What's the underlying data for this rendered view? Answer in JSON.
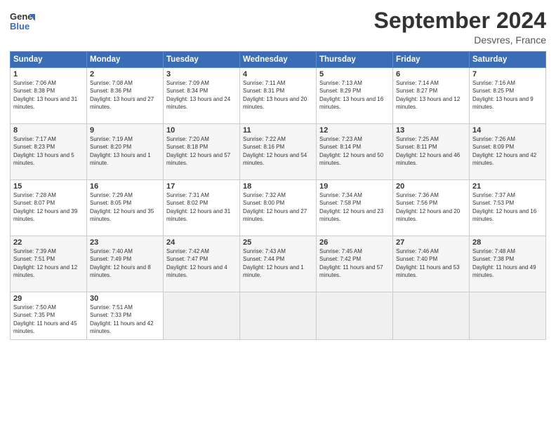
{
  "header": {
    "month_title": "September 2024",
    "location": "Desvres, France",
    "logo_line1": "General",
    "logo_line2": "Blue"
  },
  "days_of_week": [
    "Sunday",
    "Monday",
    "Tuesday",
    "Wednesday",
    "Thursday",
    "Friday",
    "Saturday"
  ],
  "weeks": [
    [
      {
        "day": "1",
        "sunrise": "Sunrise: 7:06 AM",
        "sunset": "Sunset: 8:38 PM",
        "daylight": "Daylight: 13 hours and 31 minutes."
      },
      {
        "day": "2",
        "sunrise": "Sunrise: 7:08 AM",
        "sunset": "Sunset: 8:36 PM",
        "daylight": "Daylight: 13 hours and 27 minutes."
      },
      {
        "day": "3",
        "sunrise": "Sunrise: 7:09 AM",
        "sunset": "Sunset: 8:34 PM",
        "daylight": "Daylight: 13 hours and 24 minutes."
      },
      {
        "day": "4",
        "sunrise": "Sunrise: 7:11 AM",
        "sunset": "Sunset: 8:31 PM",
        "daylight": "Daylight: 13 hours and 20 minutes."
      },
      {
        "day": "5",
        "sunrise": "Sunrise: 7:13 AM",
        "sunset": "Sunset: 8:29 PM",
        "daylight": "Daylight: 13 hours and 16 minutes."
      },
      {
        "day": "6",
        "sunrise": "Sunrise: 7:14 AM",
        "sunset": "Sunset: 8:27 PM",
        "daylight": "Daylight: 13 hours and 12 minutes."
      },
      {
        "day": "7",
        "sunrise": "Sunrise: 7:16 AM",
        "sunset": "Sunset: 8:25 PM",
        "daylight": "Daylight: 13 hours and 9 minutes."
      }
    ],
    [
      {
        "day": "8",
        "sunrise": "Sunrise: 7:17 AM",
        "sunset": "Sunset: 8:23 PM",
        "daylight": "Daylight: 13 hours and 5 minutes."
      },
      {
        "day": "9",
        "sunrise": "Sunrise: 7:19 AM",
        "sunset": "Sunset: 8:20 PM",
        "daylight": "Daylight: 13 hours and 1 minute."
      },
      {
        "day": "10",
        "sunrise": "Sunrise: 7:20 AM",
        "sunset": "Sunset: 8:18 PM",
        "daylight": "Daylight: 12 hours and 57 minutes."
      },
      {
        "day": "11",
        "sunrise": "Sunrise: 7:22 AM",
        "sunset": "Sunset: 8:16 PM",
        "daylight": "Daylight: 12 hours and 54 minutes."
      },
      {
        "day": "12",
        "sunrise": "Sunrise: 7:23 AM",
        "sunset": "Sunset: 8:14 PM",
        "daylight": "Daylight: 12 hours and 50 minutes."
      },
      {
        "day": "13",
        "sunrise": "Sunrise: 7:25 AM",
        "sunset": "Sunset: 8:11 PM",
        "daylight": "Daylight: 12 hours and 46 minutes."
      },
      {
        "day": "14",
        "sunrise": "Sunrise: 7:26 AM",
        "sunset": "Sunset: 8:09 PM",
        "daylight": "Daylight: 12 hours and 42 minutes."
      }
    ],
    [
      {
        "day": "15",
        "sunrise": "Sunrise: 7:28 AM",
        "sunset": "Sunset: 8:07 PM",
        "daylight": "Daylight: 12 hours and 39 minutes."
      },
      {
        "day": "16",
        "sunrise": "Sunrise: 7:29 AM",
        "sunset": "Sunset: 8:05 PM",
        "daylight": "Daylight: 12 hours and 35 minutes."
      },
      {
        "day": "17",
        "sunrise": "Sunrise: 7:31 AM",
        "sunset": "Sunset: 8:02 PM",
        "daylight": "Daylight: 12 hours and 31 minutes."
      },
      {
        "day": "18",
        "sunrise": "Sunrise: 7:32 AM",
        "sunset": "Sunset: 8:00 PM",
        "daylight": "Daylight: 12 hours and 27 minutes."
      },
      {
        "day": "19",
        "sunrise": "Sunrise: 7:34 AM",
        "sunset": "Sunset: 7:58 PM",
        "daylight": "Daylight: 12 hours and 23 minutes."
      },
      {
        "day": "20",
        "sunrise": "Sunrise: 7:36 AM",
        "sunset": "Sunset: 7:56 PM",
        "daylight": "Daylight: 12 hours and 20 minutes."
      },
      {
        "day": "21",
        "sunrise": "Sunrise: 7:37 AM",
        "sunset": "Sunset: 7:53 PM",
        "daylight": "Daylight: 12 hours and 16 minutes."
      }
    ],
    [
      {
        "day": "22",
        "sunrise": "Sunrise: 7:39 AM",
        "sunset": "Sunset: 7:51 PM",
        "daylight": "Daylight: 12 hours and 12 minutes."
      },
      {
        "day": "23",
        "sunrise": "Sunrise: 7:40 AM",
        "sunset": "Sunset: 7:49 PM",
        "daylight": "Daylight: 12 hours and 8 minutes."
      },
      {
        "day": "24",
        "sunrise": "Sunrise: 7:42 AM",
        "sunset": "Sunset: 7:47 PM",
        "daylight": "Daylight: 12 hours and 4 minutes."
      },
      {
        "day": "25",
        "sunrise": "Sunrise: 7:43 AM",
        "sunset": "Sunset: 7:44 PM",
        "daylight": "Daylight: 12 hours and 1 minute."
      },
      {
        "day": "26",
        "sunrise": "Sunrise: 7:45 AM",
        "sunset": "Sunset: 7:42 PM",
        "daylight": "Daylight: 11 hours and 57 minutes."
      },
      {
        "day": "27",
        "sunrise": "Sunrise: 7:46 AM",
        "sunset": "Sunset: 7:40 PM",
        "daylight": "Daylight: 11 hours and 53 minutes."
      },
      {
        "day": "28",
        "sunrise": "Sunrise: 7:48 AM",
        "sunset": "Sunset: 7:38 PM",
        "daylight": "Daylight: 11 hours and 49 minutes."
      }
    ],
    [
      {
        "day": "29",
        "sunrise": "Sunrise: 7:50 AM",
        "sunset": "Sunset: 7:35 PM",
        "daylight": "Daylight: 11 hours and 45 minutes."
      },
      {
        "day": "30",
        "sunrise": "Sunrise: 7:51 AM",
        "sunset": "Sunset: 7:33 PM",
        "daylight": "Daylight: 11 hours and 42 minutes."
      },
      {
        "day": "",
        "sunrise": "",
        "sunset": "",
        "daylight": ""
      },
      {
        "day": "",
        "sunrise": "",
        "sunset": "",
        "daylight": ""
      },
      {
        "day": "",
        "sunrise": "",
        "sunset": "",
        "daylight": ""
      },
      {
        "day": "",
        "sunrise": "",
        "sunset": "",
        "daylight": ""
      },
      {
        "day": "",
        "sunrise": "",
        "sunset": "",
        "daylight": ""
      }
    ]
  ]
}
